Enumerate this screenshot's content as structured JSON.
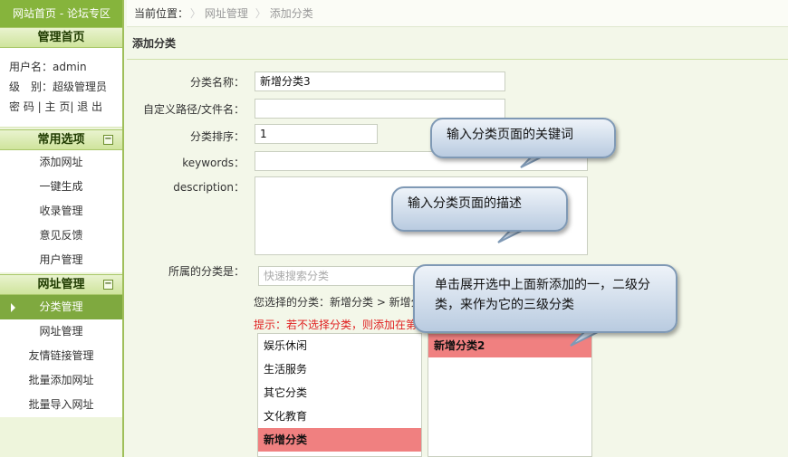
{
  "sidebar": {
    "top_link": "网站首页 - 论坛专区",
    "admin_home": "管理首页",
    "username_line": "用户名：admin",
    "level_line": "级　别：超级管理员",
    "links": [
      "密 码",
      "主 页",
      "退 出"
    ],
    "groups": [
      {
        "title": "常用选项",
        "toggle": "−",
        "items": [
          "添加网址",
          "一键生成",
          "收录管理",
          "意见反馈",
          "用户管理"
        ]
      },
      {
        "title": "网址管理",
        "toggle": "−",
        "items": [
          "分类管理",
          "网址管理",
          "友情链接管理",
          "批量添加网址",
          "批量导入网址"
        ]
      }
    ],
    "active_item": "分类管理"
  },
  "breadcrumb": {
    "label": "当前位置：",
    "items": [
      "网址管理",
      "添加分类"
    ]
  },
  "section_title": "添加分类",
  "form": {
    "name_label": "分类名称：",
    "name_value": "新增分类3",
    "path_label": "自定义路径/文件名：",
    "path_value": "",
    "order_label": "分类排序：",
    "order_value": "1",
    "keywords_label": "keywords：",
    "keywords_value": "",
    "description_label": "description：",
    "description_value": "",
    "parent_label": "所属的分类是：",
    "search_placeholder": "快速搜索分类",
    "selected_text": "您选择的分类：新增分类 > 新增分类2",
    "hint_text": "提示：若不选择分类，则添加在第一级分类",
    "list1": [
      "娱乐休闲",
      "生活服务",
      "其它分类",
      "文化教育",
      "新增分类"
    ],
    "list1_selected": 4,
    "list2": [
      "新增分类2"
    ],
    "list2_selected": 0
  },
  "callouts": {
    "keywords": "输入分类页面的关键词",
    "description": "输入分类页面的描述",
    "category": "单击展开选中上面新添加的一，二级分类，来作为它的三级分类"
  }
}
